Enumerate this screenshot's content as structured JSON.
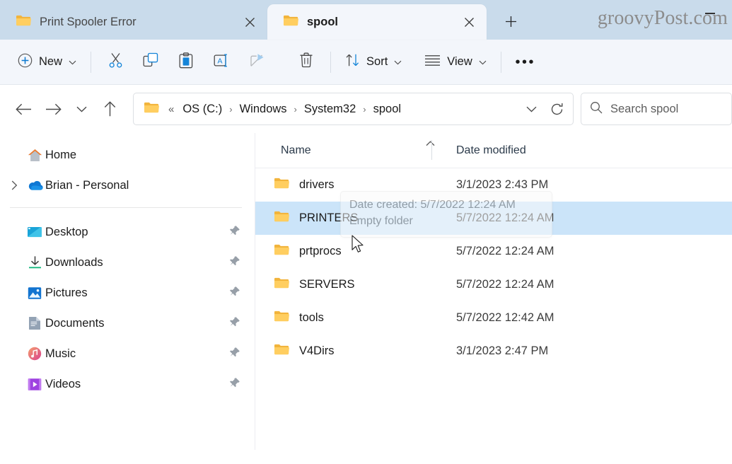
{
  "window": {
    "watermark": "groovyPost.com",
    "minimize_label": "Minimize"
  },
  "tabs": [
    {
      "title": "Print Spooler Error",
      "icon": "folder-icon",
      "active": false,
      "close_label": "Close tab"
    },
    {
      "title": "spool",
      "icon": "folder-icon",
      "active": true,
      "close_label": "Close tab"
    }
  ],
  "newtab": {
    "label": "Add new tab",
    "icon": "plus-icon"
  },
  "toolbar": {
    "new_label": "New",
    "cut_label": "Cut",
    "copy_label": "Copy",
    "paste_label": "Paste",
    "rename_label": "Rename",
    "share_label": "Share",
    "delete_label": "Delete",
    "sort_label": "Sort",
    "view_label": "View",
    "more_label": "See more"
  },
  "address": {
    "back_label": "Back",
    "forward_label": "Forward",
    "recent_label": "Recent locations",
    "up_label": "Up to System32",
    "ellipsis": "«",
    "crumbs": [
      "OS (C:)",
      "Windows",
      "System32",
      "spool"
    ],
    "separator": "›",
    "dropdown_label": "Previous locations",
    "refresh_label": "Refresh"
  },
  "search": {
    "placeholder": "Search spool",
    "icon": "search-icon"
  },
  "sidebar": {
    "items": [
      {
        "label": "Home",
        "icon": "home-icon",
        "pinned": false,
        "expandable": false
      },
      {
        "label": "Brian - Personal",
        "icon": "onedrive-icon",
        "pinned": false,
        "expandable": true
      },
      {
        "label": "Desktop",
        "icon": "desktop-icon",
        "pinned": true,
        "expandable": false
      },
      {
        "label": "Downloads",
        "icon": "downloads-icon",
        "pinned": true,
        "expandable": false
      },
      {
        "label": "Pictures",
        "icon": "pictures-icon",
        "pinned": true,
        "expandable": false
      },
      {
        "label": "Documents",
        "icon": "documents-icon",
        "pinned": true,
        "expandable": false
      },
      {
        "label": "Music",
        "icon": "music-icon",
        "pinned": true,
        "expandable": false
      },
      {
        "label": "Videos",
        "icon": "videos-icon",
        "pinned": true,
        "expandable": false
      }
    ]
  },
  "filelist": {
    "columns": {
      "name": "Name",
      "date_modified": "Date modified"
    },
    "sort": {
      "column": "Name",
      "direction": "ascending"
    },
    "rows": [
      {
        "name": "drivers",
        "date_modified": "3/1/2023 2:43 PM",
        "selected": false
      },
      {
        "name": "PRINTERS",
        "date_modified": "5/7/2022 12:24 AM",
        "selected": true
      },
      {
        "name": "prtprocs",
        "date_modified": "5/7/2022 12:24 AM",
        "selected": false
      },
      {
        "name": "SERVERS",
        "date_modified": "5/7/2022 12:24 AM",
        "selected": false
      },
      {
        "name": "tools",
        "date_modified": "5/7/2022 12:42 AM",
        "selected": false
      },
      {
        "name": "V4Dirs",
        "date_modified": "3/1/2023 2:47 PM",
        "selected": false
      }
    ]
  },
  "tooltip": {
    "line1": "Date created: 5/7/2022 12:24 AM",
    "line2": "Empty folder"
  },
  "colors": {
    "accent": "#0078d4",
    "tabstrip": "#c9dbeb",
    "chrome": "#f3f6fb",
    "selection": "#cbe4f9",
    "folder": "#ffd169"
  }
}
